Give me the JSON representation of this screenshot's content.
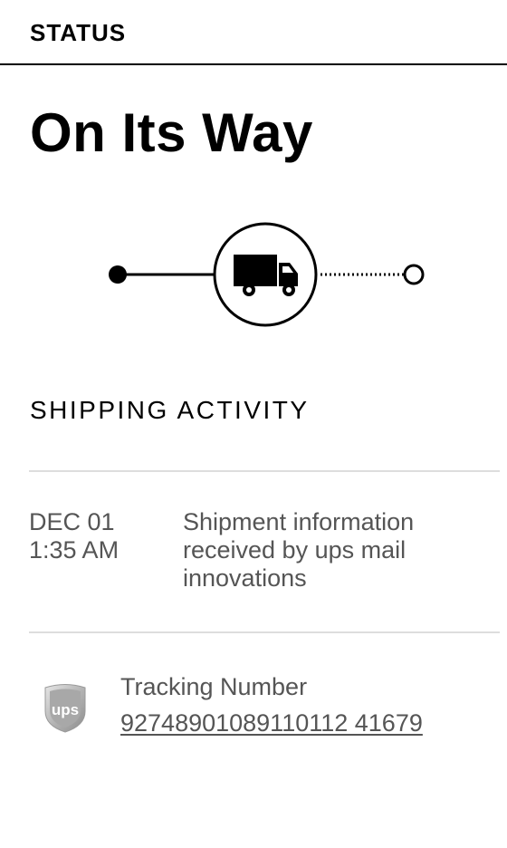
{
  "header": {
    "title": "STATUS"
  },
  "status": {
    "title": "On Its Way",
    "progress_icon": "truck-icon",
    "progress_step": "2 of 3"
  },
  "shipping_activity": {
    "heading": "SHIPPING ACTIVITY",
    "events": [
      {
        "date": "DEC 01",
        "time": "1:35 AM",
        "description": "Shipment information received by ups mail innovations"
      }
    ]
  },
  "tracking": {
    "carrier_logo": "ups-logo",
    "carrier_logo_text": "ups",
    "label": "Tracking Number",
    "number": "92748901089110112 41679"
  },
  "colors": {
    "text_primary": "#000000",
    "text_secondary": "#555555",
    "divider": "#dddddd"
  }
}
